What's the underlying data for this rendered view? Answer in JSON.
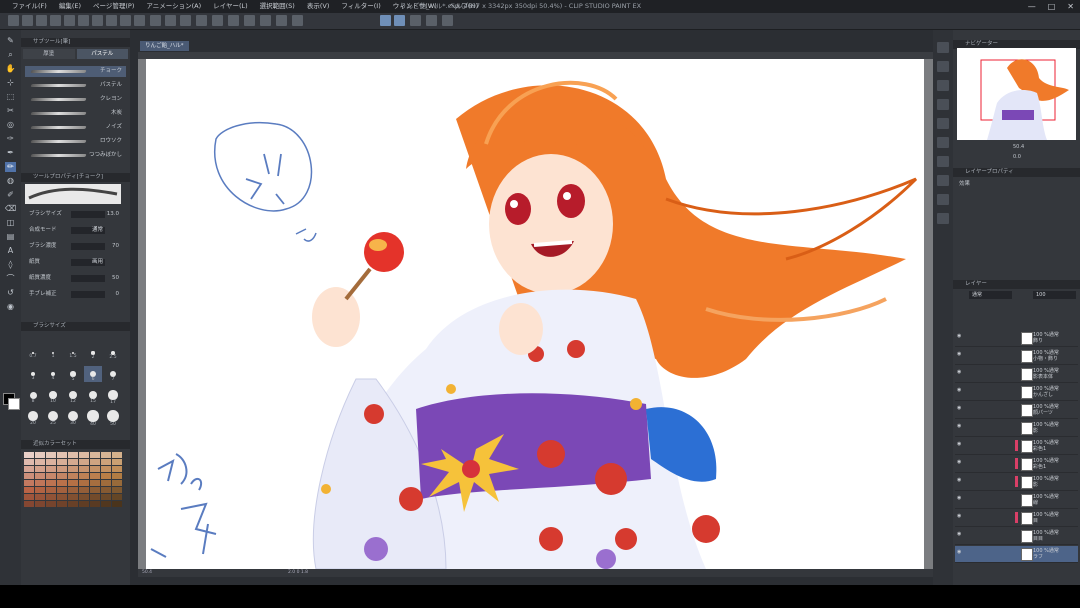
{
  "app": {
    "title": "りんご飴_ハル*.clip (4697 x 3342px 350dpi 50.4%) - CLIP STUDIO PAINT EX",
    "doc_tab": "りんご飴_ハル*"
  },
  "menu": [
    "ファイル(F)",
    "編集(E)",
    "ページ管理(P)",
    "アニメーション(A)",
    "レイヤー(L)",
    "選択範囲(S)",
    "表示(V)",
    "フィルター(I)",
    "ウィンドウ(W)",
    "ヘルプ(H)"
  ],
  "window_controls": {
    "minimize": "—",
    "maximize": "□",
    "close": "✕"
  },
  "left_panel": {
    "header": "サブツール[筆]",
    "tabs": [
      "厚塗",
      "パステル"
    ],
    "brushes": [
      "チョーク",
      "パステル",
      "クレヨン",
      "木炭",
      "ノイズ",
      "ロウソク",
      "つつみぼかし"
    ],
    "props_header": "ツールプロパティ[チョーク]",
    "props": [
      {
        "label": "ブラシサイズ",
        "value": "",
        "num": "13.0"
      },
      {
        "label": "合成モード",
        "value": "通常",
        "num": ""
      },
      {
        "label": "ブラシ濃度",
        "value": "",
        "num": "70"
      },
      {
        "label": "紙質",
        "value": "画用",
        "num": ""
      },
      {
        "label": "紙質濃度",
        "value": "",
        "num": "50"
      },
      {
        "label": "手ブレ補正",
        "value": "",
        "num": "0"
      }
    ],
    "size_header": "ブラシサイズ",
    "sizes": [
      "0.7",
      "1",
      "1.5",
      "2",
      "2.5",
      "3",
      "4",
      "5",
      "6",
      "7",
      "8",
      "10",
      "12",
      "15",
      "17",
      "20",
      "25",
      "30",
      "40",
      "50"
    ],
    "swatch_header": "近似カラーセット"
  },
  "canvas": {
    "hscroll_text": "50.4",
    "coords": "2.0 0  1.8"
  },
  "right_panel": {
    "nav_header": "ナビゲーター",
    "zoom": "50.4",
    "angle": "0.0",
    "layer_prop_header": "レイヤープロパティ",
    "effect_label": "効果",
    "layer_header": "レイヤー",
    "blend_mode": "通常",
    "opacity": "100",
    "layers": [
      {
        "text": "100 %通常\n飾り",
        "sel": false,
        "mark": false
      },
      {
        "text": "100 %通常\n小物・飾り",
        "sel": false,
        "mark": false
      },
      {
        "text": "100 %通常\n影表本体",
        "sel": false,
        "mark": false
      },
      {
        "text": "100 %通常\nかんざし",
        "sel": false,
        "mark": false
      },
      {
        "text": "100 %通常\n顔パーツ",
        "sel": false,
        "mark": false
      },
      {
        "text": "100 %通常\n影",
        "sel": false,
        "mark": false
      },
      {
        "text": "100 %通常\n彩色1",
        "sel": false,
        "mark": true
      },
      {
        "text": "100 %通常\n彩色1",
        "sel": false,
        "mark": true
      },
      {
        "text": "100 %通常\n影",
        "sel": false,
        "mark": true
      },
      {
        "text": "100 %通常\n線",
        "sel": false,
        "mark": false
      },
      {
        "text": "100 %通常\n目",
        "sel": false,
        "mark": true
      },
      {
        "text": "100 %通常\n目目",
        "sel": false,
        "mark": false
      },
      {
        "text": "100 %通常\nラフ",
        "sel": true,
        "mark": false
      }
    ]
  },
  "colors": {
    "accent": "#5072a8",
    "panel": "#34373c",
    "hair": "#f07a2a",
    "kimono": "#eef0fb",
    "obi": "#7b48b6",
    "flower": "#d63a2f"
  }
}
